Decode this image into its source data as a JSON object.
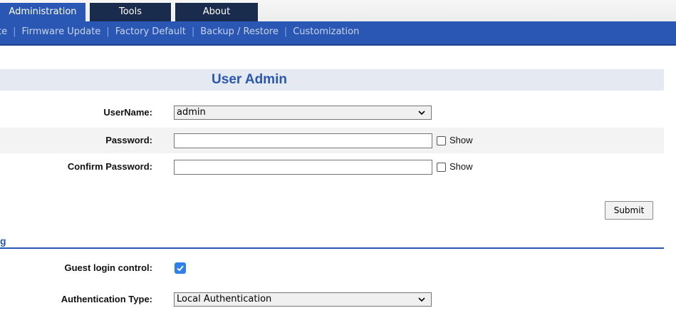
{
  "tabs": [
    {
      "label": "Administration",
      "active": true
    },
    {
      "label": "Tools",
      "active": false
    },
    {
      "label": "About",
      "active": false
    }
  ],
  "subnav": [
    "te",
    "Firmware Update",
    "Factory Default",
    "Backup / Restore",
    "Customization"
  ],
  "section": {
    "title": "User Admin"
  },
  "form": {
    "username_label": "UserName:",
    "username_value": "admin",
    "password_label": "Password:",
    "password_value": "",
    "confirm_label": "Confirm Password:",
    "confirm_value": "",
    "show_label": "Show",
    "submit_label": "Submit"
  },
  "section2": {
    "title_fragment": "g",
    "guest_label": "Guest login control:",
    "guest_checked": true,
    "auth_label": "Authentication Type:",
    "auth_value": "Local Authentication"
  },
  "colors": {
    "accent": "#2a56b4",
    "tab_dark": "#1a2c4e",
    "checkbox": "#2f80ed"
  },
  "icons": {
    "dropdown": "chevron-down-icon",
    "check": "checkmark-icon"
  }
}
